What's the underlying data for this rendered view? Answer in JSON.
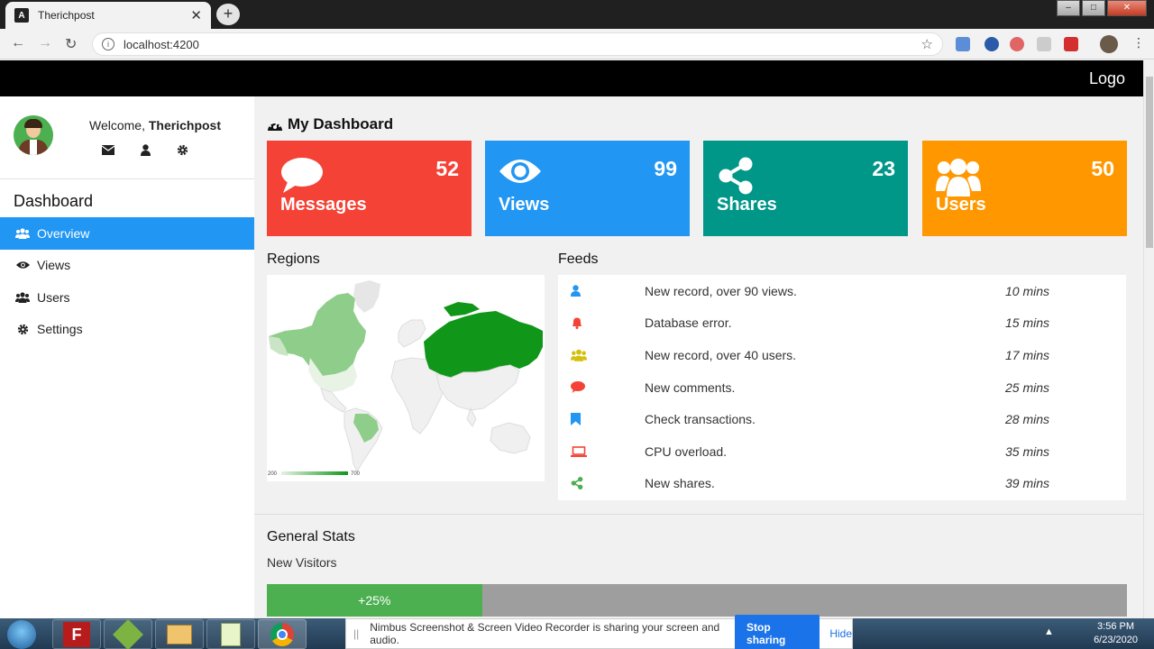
{
  "browser": {
    "tab_title": "Therichpost",
    "tab_icon_letter": "A",
    "close_tab": "✕",
    "new_tab": "+",
    "url": "localhost:4200",
    "back": "←",
    "forward": "→",
    "reload": "↻",
    "bookmark_star": "☆",
    "menu": "⋮",
    "win_min": "–",
    "win_max": "□",
    "win_close": "✕"
  },
  "topnav": {
    "logo": "Logo"
  },
  "sidebar": {
    "welcome_prefix": "Welcome, ",
    "username": "Therichpost",
    "section_title": "Dashboard",
    "items": [
      {
        "label": "Overview",
        "icon": "users-icon",
        "active": true
      },
      {
        "label": "Views",
        "icon": "eye-icon",
        "active": false
      },
      {
        "label": "Users",
        "icon": "users-icon",
        "active": false
      },
      {
        "label": "Settings",
        "icon": "gear-icon",
        "active": false
      }
    ]
  },
  "dashboard": {
    "title": "My Dashboard",
    "cards": [
      {
        "label": "Messages",
        "value": "52",
        "color": "#f44336",
        "icon": "comment-icon"
      },
      {
        "label": "Views",
        "value": "99",
        "color": "#2196f3",
        "icon": "eye-icon"
      },
      {
        "label": "Shares",
        "value": "23",
        "color": "#009688",
        "icon": "share-icon"
      },
      {
        "label": "Users",
        "value": "50",
        "color": "#ff9800",
        "icon": "users-icon"
      }
    ]
  },
  "regions": {
    "title": "Regions",
    "legend_min": "200",
    "legend_max": "700"
  },
  "feeds": {
    "title": "Feeds",
    "items": [
      {
        "icon": "user-icon",
        "color": "#2196f3",
        "text": "New record, over 90 views.",
        "time": "10 mins"
      },
      {
        "icon": "bell-icon",
        "color": "#f44336",
        "text": "Database error.",
        "time": "15 mins"
      },
      {
        "icon": "users-icon",
        "color": "#d4c00a",
        "text": "New record, over 40 users.",
        "time": "17 mins"
      },
      {
        "icon": "comment-icon",
        "color": "#f44336",
        "text": "New comments.",
        "time": "25 mins"
      },
      {
        "icon": "bookmark-icon",
        "color": "#2196f3",
        "text": "Check transactions.",
        "time": "28 mins"
      },
      {
        "icon": "laptop-icon",
        "color": "#f44336",
        "text": "CPU overload.",
        "time": "35 mins"
      },
      {
        "icon": "share-icon",
        "color": "#4caf50",
        "text": "New shares.",
        "time": "39 mins"
      }
    ]
  },
  "stats": {
    "title": "General Stats",
    "subtitle": "New Visitors",
    "progress_label": "+25%",
    "progress_value": 0.25
  },
  "share_notice": {
    "grip": "||",
    "text": "Nimbus Screenshot & Screen Video Recorder is sharing your screen and audio.",
    "stop": "Stop sharing",
    "hide": "Hide"
  },
  "taskbar": {
    "time": "3:56 PM",
    "date": "6/23/2020",
    "tray_arrow": "▲"
  }
}
